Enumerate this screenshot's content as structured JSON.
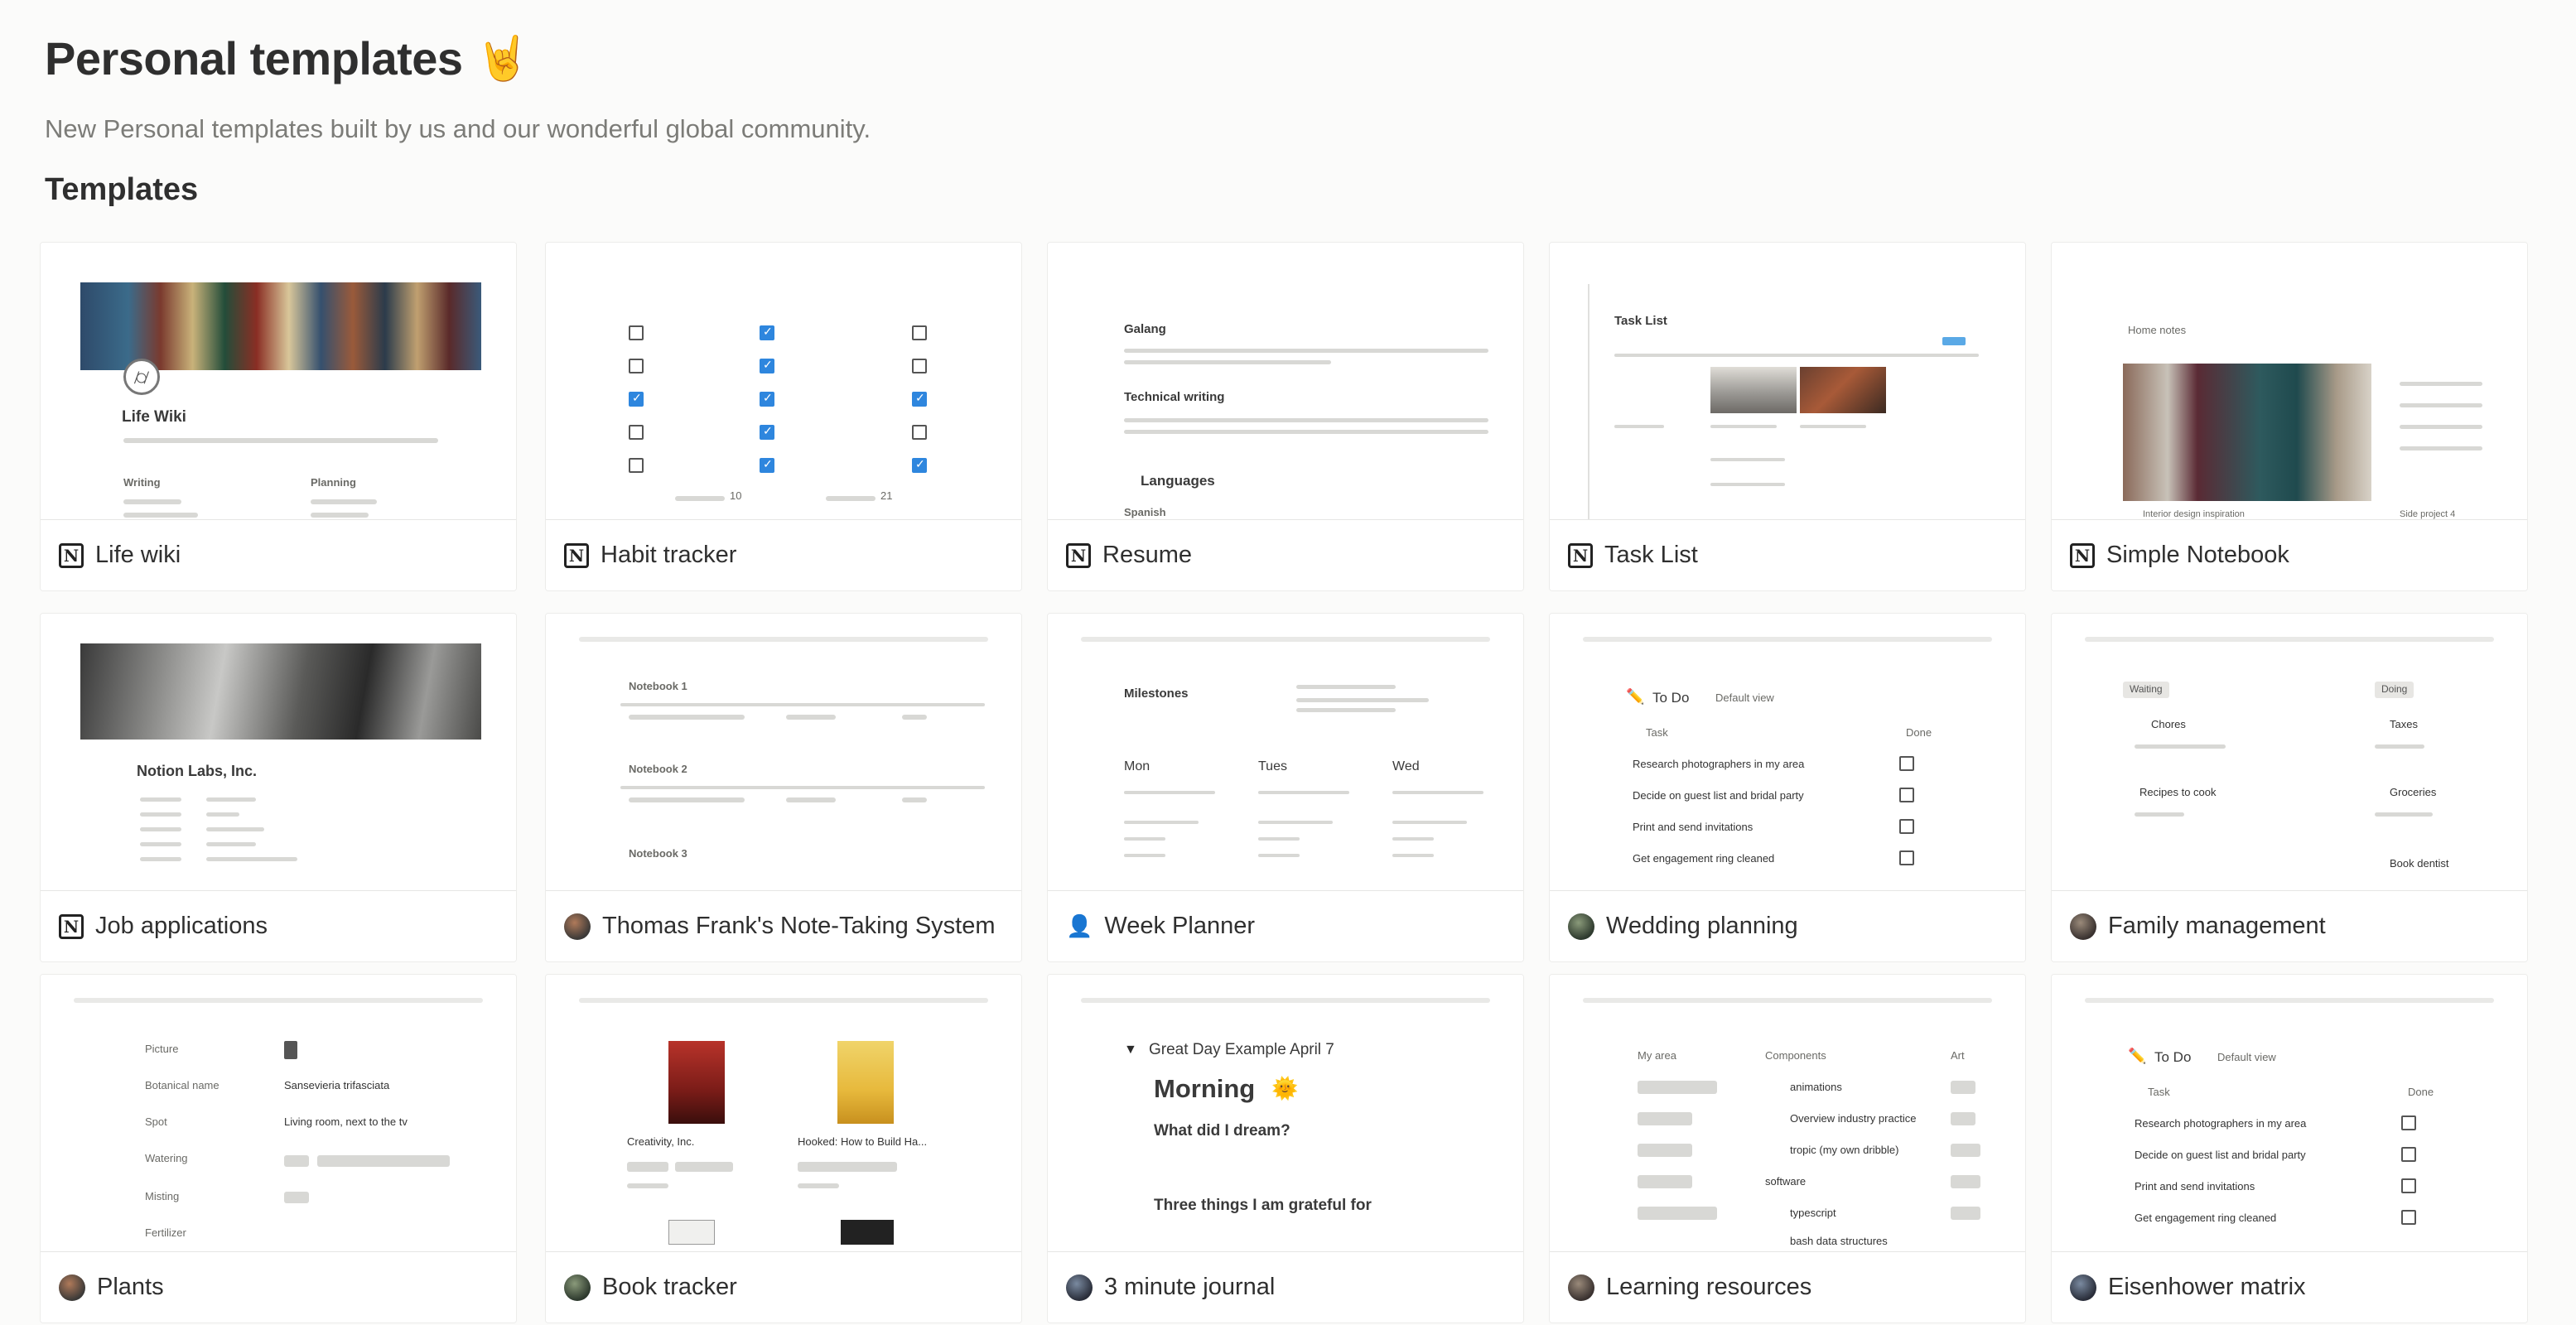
{
  "header": {
    "title": "Personal templates",
    "title_emoji": "🤘",
    "subtitle": "New Personal templates built by us and our wonderful global community.",
    "section": "Templates"
  },
  "cards": [
    {
      "name": "Life wiki",
      "icon": "notion-icon"
    },
    {
      "name": "Habit tracker",
      "icon": "notion-icon"
    },
    {
      "name": "Resume",
      "icon": "notion-icon"
    },
    {
      "name": "Task List",
      "icon": "notion-icon"
    },
    {
      "name": "Simple Notebook",
      "icon": "notion-icon"
    },
    {
      "name": "Job applications",
      "icon": "notion-icon"
    },
    {
      "name": "Thomas Frank's Note-Taking System",
      "icon": "avatar-icon"
    },
    {
      "name": "Week Planner",
      "icon": "person-icon"
    },
    {
      "name": "Wedding planning",
      "icon": "avatar-icon"
    },
    {
      "name": "Family management",
      "icon": "avatar-icon"
    },
    {
      "name": "Plants",
      "icon": "avatar-icon"
    },
    {
      "name": "Book tracker",
      "icon": "avatar-icon"
    },
    {
      "name": "3 minute journal",
      "icon": "avatar-icon"
    },
    {
      "name": "Learning resources",
      "icon": "avatar-icon"
    },
    {
      "name": "Eisenhower matrix",
      "icon": "avatar-icon"
    }
  ],
  "previews": {
    "life_wiki": {
      "title": "Life Wiki",
      "col1": "Writing",
      "col2": "Planning"
    },
    "habit": {
      "count1": "10",
      "count2": "21"
    },
    "resume": {
      "h1": "Galang",
      "h2": "Technical writing",
      "h3": "Languages",
      "h4": "Spanish"
    },
    "task_list": {
      "title": "Task List"
    },
    "notebook": {
      "title": "Home notes",
      "c1": "Interior design inspiration",
      "c2": "Side project 4"
    },
    "job": {
      "title": "Notion Labs, Inc."
    },
    "thomas": {
      "n1": "Notebook 1",
      "n2": "Notebook 2",
      "n3": "Notebook 3"
    },
    "week": {
      "title": "Milestones",
      "d1": "Mon",
      "d2": "Tues",
      "d3": "Wed"
    },
    "wedding": {
      "title": "To Do",
      "view": "Default view",
      "col": "Task",
      "done": "Done",
      "rows": [
        "Research photographers in my area",
        "Decide on guest list and bridal party",
        "Print and send invitations",
        "Get engagement ring cleaned"
      ]
    },
    "family": {
      "s1": "Waiting",
      "s2": "Doing",
      "i1": "Chores",
      "i2": "Taxes",
      "i3": "Recipes to cook",
      "i4": "Groceries",
      "i5": "Book dentist"
    },
    "plants": {
      "l1": "Picture",
      "l2": "Botanical name",
      "l3": "Spot",
      "l4": "Watering",
      "l5": "Misting",
      "l6": "Fertilizer",
      "v2": "Sansevieria trifasciata",
      "v3": "Living room, next to the tv"
    },
    "book": {
      "b1": "Creativity, Inc.",
      "b2": "Hooked: How to Build Ha..."
    },
    "journal": {
      "title": "Great Day Example April 7",
      "h1": "Morning",
      "q1": "What did I dream?",
      "q2": "Three things I am grateful for"
    },
    "learning": {
      "c1": "My area",
      "c2": "Components",
      "c3": "Art",
      "r1": "animations",
      "r2": "Overview industry practice",
      "r3": "tropic (my own dribble)",
      "r4": "software",
      "r5": "typescript",
      "r6": "bash data structures"
    },
    "eisenhower": {
      "title": "To Do",
      "view": "Default view",
      "col": "Task",
      "done": "Done",
      "rows": [
        "Research photographers in my area",
        "Decide on guest list and bridal party",
        "Print and send invitations",
        "Get engagement ring cleaned"
      ]
    }
  }
}
